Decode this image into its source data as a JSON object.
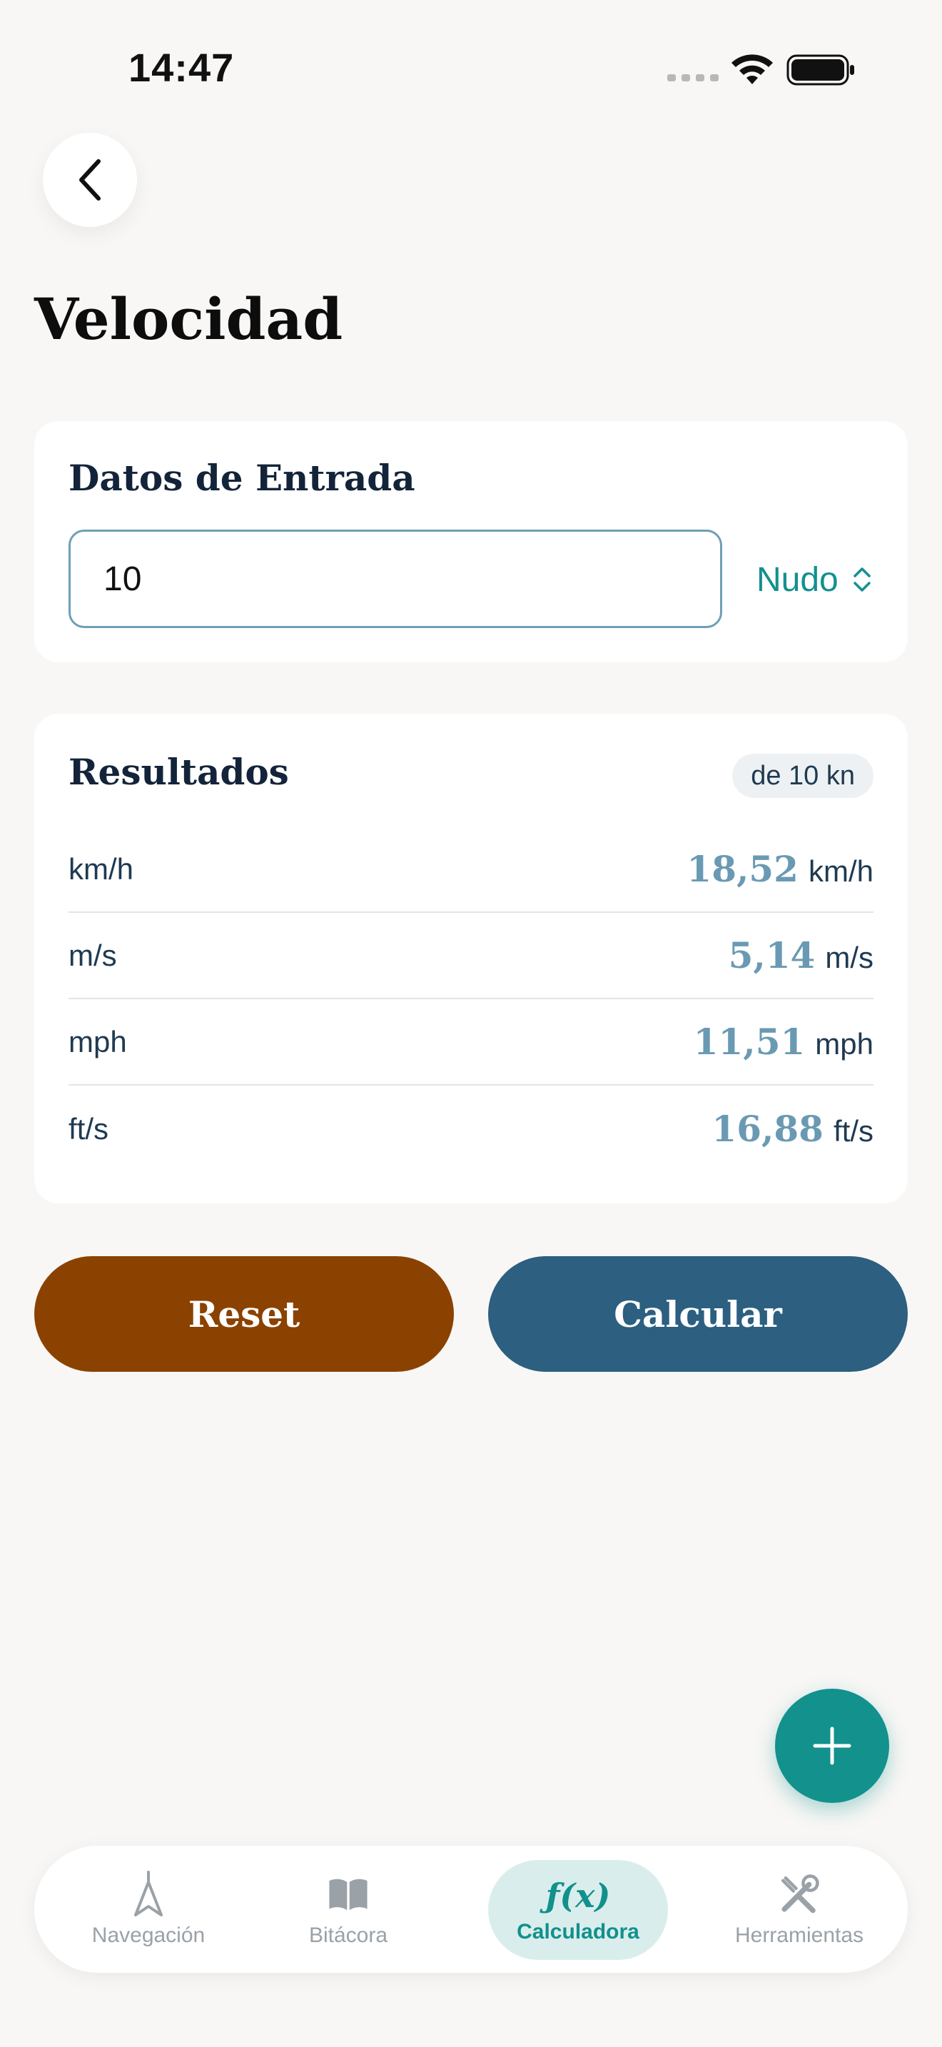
{
  "status_bar": {
    "time": "14:47"
  },
  "page": {
    "title": "Velocidad"
  },
  "input_card": {
    "title": "Datos de Entrada",
    "value": "10",
    "unit": "Nudo"
  },
  "results_card": {
    "title": "Resultados",
    "badge": "de 10 kn",
    "rows": [
      {
        "label": "km/h",
        "value": "18,52",
        "unit": "km/h"
      },
      {
        "label": "m/s",
        "value": "5,14",
        "unit": "m/s"
      },
      {
        "label": "mph",
        "value": "11,51",
        "unit": "mph"
      },
      {
        "label": "ft/s",
        "value": "16,88",
        "unit": "ft/s"
      }
    ]
  },
  "actions": {
    "reset_label": "Reset",
    "calculate_label": "Calcular"
  },
  "fab": {
    "icon": "plus-icon"
  },
  "tab_bar": {
    "tabs": [
      {
        "label": "Navegación",
        "icon": "navigation-arrow-icon"
      },
      {
        "label": "Bitácora",
        "icon": "book-icon"
      },
      {
        "label": "Calculadora",
        "icon": "function-icon",
        "icon_text": "ƒ(x)",
        "active": true
      },
      {
        "label": "Herramientas",
        "icon": "tools-icon"
      }
    ]
  },
  "colors": {
    "background": "#f8f7f5",
    "accent": "#12918d",
    "reset": "#8b4200",
    "calculate": "#2c5f80",
    "result_value": "#6a9ab3"
  }
}
